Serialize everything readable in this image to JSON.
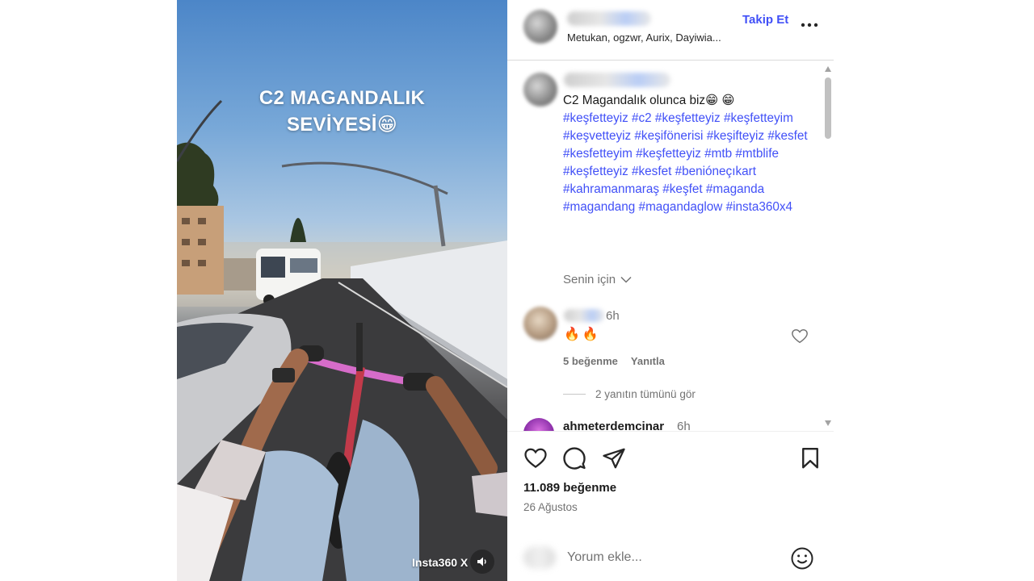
{
  "media": {
    "overlay_line1": "C2 MAGANDALIK",
    "overlay_line2": "SEVİYESİ😁",
    "watermark": "Insta360 X",
    "icons": {
      "sound": "speaker-icon"
    }
  },
  "header": {
    "subtitle": "Metukan, ogzwr, Aurix, Dayiwia...",
    "follow_label": "Takip Et",
    "icons": {
      "more": "more-dots-icon"
    }
  },
  "caption": {
    "text": "C2 Magandalık olunca biz😁 😁",
    "hashtags": "#keşfetteyiz #c2 #keşfetteyiz #keşfetteyim #keşvetteyiz #keşifönerisi #keşifteyiz #kesfet #kesfetteyim #keşfetteyiz #mtb #mtblife #keşfetteyiz #kesfet #benióneçıkart #kahramanmaraş #keşfet #maganda #magandang #magandaglow #insta360x4"
  },
  "for_you_label": "Senin için",
  "comments": [
    {
      "time": "6h",
      "text": "🔥🔥",
      "likes_label": "5 beğenme",
      "reply_label": "Yanıtla",
      "view_replies_label": "2 yanıtın tümünü gör"
    },
    {
      "username": "ahmeterdemcinar",
      "time": "6h"
    }
  ],
  "actions": {
    "likes_count": "11.089 beğenme",
    "date": "26 Ağustos",
    "icons": [
      "heart-icon",
      "comment-icon",
      "share-icon",
      "bookmark-icon"
    ]
  },
  "comment_bar": {
    "placeholder": "Yorum ekle...",
    "icons": {
      "emoji": "emoji-icon"
    }
  },
  "colors": {
    "link_blue": "#4150f7",
    "muted_text": "#737373",
    "divider": "#dbdbdb"
  }
}
